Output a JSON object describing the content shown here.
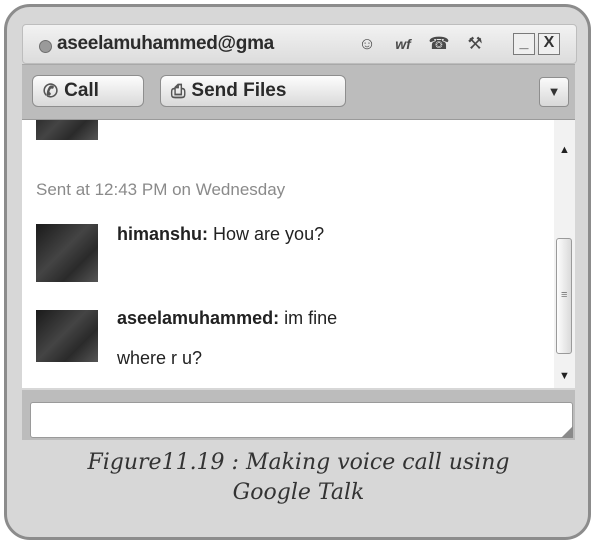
{
  "window": {
    "title": "aseelamuhammed@gma",
    "title_icons": [
      "smiley-icon",
      "wf-icon",
      "phone-icon",
      "wrench-icon"
    ],
    "minimize_label": "_",
    "close_label": "X"
  },
  "toolbar": {
    "call_label": "Call",
    "send_files_label": "Send Files",
    "menu_arrow": "▼"
  },
  "chat": {
    "timestamp": "Sent at 12:43 PM on Wednesday",
    "messages": [
      {
        "sender": "himanshu:",
        "lines": [
          "How are you?"
        ]
      },
      {
        "sender": "aseelamuhammed:",
        "lines": [
          "im fine",
          "where r u?"
        ]
      }
    ]
  },
  "input": {
    "value": ""
  },
  "caption": {
    "line1": "Figure11.19 : Making voice call using",
    "line2": "Google Talk"
  },
  "colors": {
    "frame": "#d7d7d7",
    "toolbar": "#bcbcbc",
    "chat_bg": "#ffffff"
  }
}
